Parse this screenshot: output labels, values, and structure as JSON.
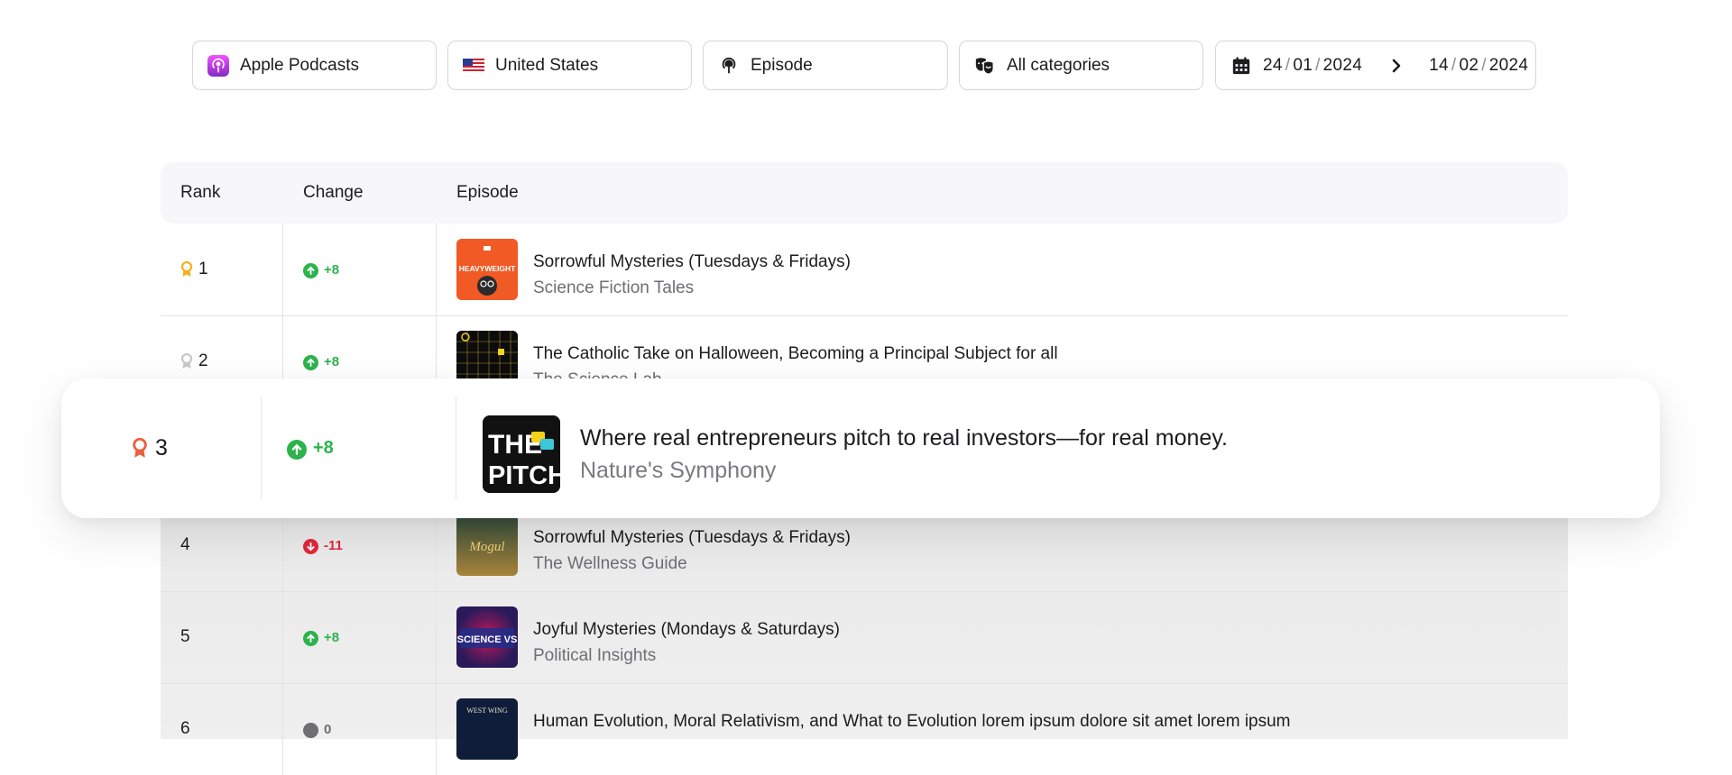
{
  "filters": {
    "platform": "Apple Podcasts",
    "country": "United States",
    "type": "Episode",
    "category": "All categories",
    "date_from": {
      "day": "24",
      "month": "01",
      "year": "2024"
    },
    "date_to": {
      "day": "14",
      "month": "02",
      "year": "2024"
    },
    "date_separator": "/"
  },
  "table": {
    "headers": {
      "rank": "Rank",
      "change": "Change",
      "episode": "Episode"
    },
    "rows": [
      {
        "rank": "1",
        "change": "+8",
        "direction": "up",
        "title": "Sorrowful Mysteries (Tuesdays & Fridays)",
        "podcast": "Science Fiction Tales",
        "thumb": "heavyweight",
        "thumb_text": "HEAVYWEIGHT"
      },
      {
        "rank": "2",
        "change": "+8",
        "direction": "up",
        "title": "The Catholic Take on Halloween, Becoming a Principal Subject for all",
        "podcast": "The Science Lab",
        "thumb": "grid"
      },
      {
        "rank": "4",
        "change": "-11",
        "direction": "down",
        "title": "Sorrowful Mysteries (Tuesdays & Fridays)",
        "podcast": "The Wellness Guide",
        "thumb": "mogul",
        "thumb_text": "Mogul"
      },
      {
        "rank": "5",
        "change": "+8",
        "direction": "up",
        "title": "Joyful Mysteries (Mondays & Saturdays)",
        "podcast": "Political Insights",
        "thumb": "science-vs",
        "thumb_text": "SCIENCE VS"
      },
      {
        "rank": "6",
        "change": "0",
        "direction": "neutral",
        "title": "Human Evolution, Moral Relativism, and What to Evolution lorem ipsum dolore sit amet lorem ipsum",
        "podcast": "",
        "thumb": "west-wing",
        "thumb_text": "WEST WING"
      }
    ]
  },
  "highlight": {
    "rank": "3",
    "change": "+8",
    "direction": "up",
    "title": "Where real entrepreneurs pitch to real investors—for real money.",
    "podcast": "Nature's Symphony",
    "thumb_line1": "THE",
    "thumb_line2": "PITCH"
  },
  "colors": {
    "up": "#2db24c",
    "down": "#e0283c",
    "gold": "#f2b01e",
    "silver": "#c7c7cc",
    "bronze": "#e8603c"
  }
}
